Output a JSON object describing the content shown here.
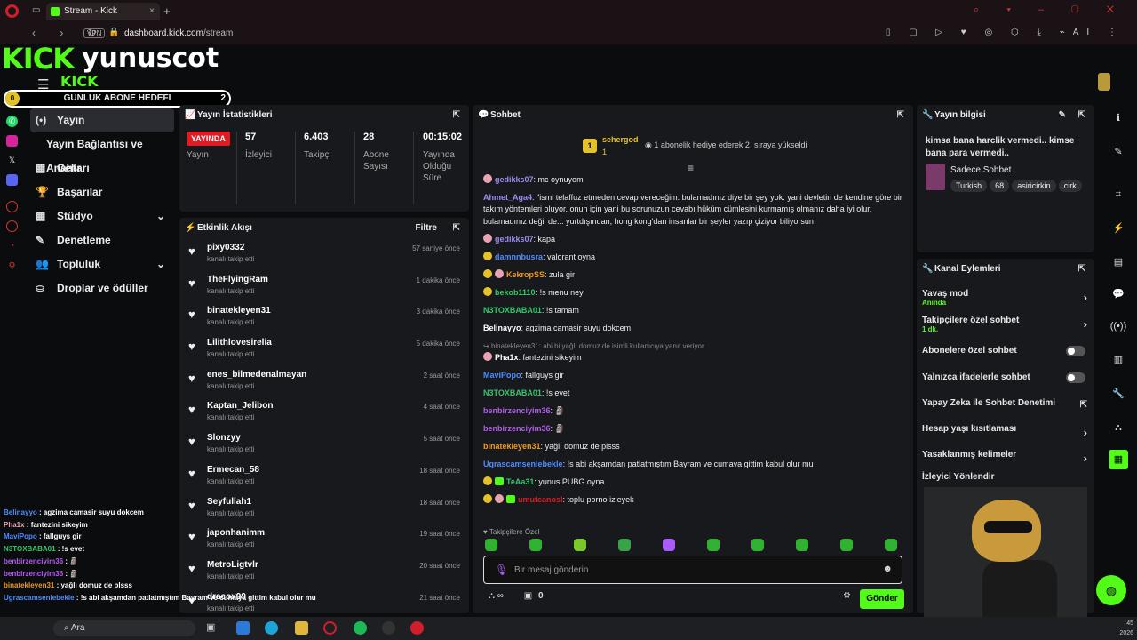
{
  "browser": {
    "tab_title": "Stream - Kick Dashboard",
    "url_domain": "dashboard.kick.com",
    "url_path": "/stream",
    "vpn": "VPN",
    "ext_label": "AI"
  },
  "header": {
    "logo": "KICK",
    "channel": "yunuscot",
    "logo_small": "KICK",
    "goal_label": "GUNLUK ABONE HEDEFI",
    "goal_start": "0",
    "goal_target": "2"
  },
  "sidenav": [
    {
      "label": "Yayın",
      "icon": "(•)"
    },
    {
      "label": "Yayın Bağlantısı ve Anahtarı",
      "icon": ""
    },
    {
      "label": "Gelir",
      "icon": "▦"
    },
    {
      "label": "Başarılar",
      "icon": "🏆"
    },
    {
      "label": "Stüdyo",
      "icon": "▦",
      "chev": "⌄"
    },
    {
      "label": "Denetleme",
      "icon": "✎"
    },
    {
      "label": "Topluluk",
      "icon": "👥",
      "chev": "⌄"
    },
    {
      "label": "Droplar ve ödüller",
      "icon": "⛀"
    }
  ],
  "stats": {
    "title": "Yayın İstatistikleri",
    "live": "YAYINDA",
    "live_label": "Yayın",
    "items": [
      {
        "value": "57",
        "label": "İzleyici"
      },
      {
        "value": "6.403",
        "label": "Takipçi"
      },
      {
        "value": "28",
        "label": "Abone Sayısı"
      },
      {
        "value": "00:15:02",
        "label": "Yayında Olduğu Süre"
      }
    ]
  },
  "activity": {
    "title": "Etkinlik Akışı",
    "filter": "Filtre",
    "sub": "kanalı takip etti",
    "items": [
      {
        "name": "pixy0332",
        "time": "57 saniye önce"
      },
      {
        "name": "TheFlyingRam",
        "time": "1 dakika önce"
      },
      {
        "name": "binatekleyen31",
        "time": "3 dakika önce"
      },
      {
        "name": "Lilithlovesirelia",
        "time": "5 dakika önce"
      },
      {
        "name": "enes_bilmedenalmayan",
        "time": "2 saat önce"
      },
      {
        "name": "Kaptan_Jelibon",
        "time": "4 saat önce"
      },
      {
        "name": "Slonzyy",
        "time": "5 saat önce"
      },
      {
        "name": "Ermecan_58",
        "time": "18 saat önce"
      },
      {
        "name": "Seyfullah1",
        "time": "18 saat önce"
      },
      {
        "name": "japonhanimm",
        "time": "19 saat önce"
      },
      {
        "name": "MetroLigtvlr",
        "time": "20 saat önce"
      },
      {
        "name": "dracox99",
        "time": "21 saat önce"
      }
    ]
  },
  "chat": {
    "title": "Sohbet",
    "pinned_user": "sehergod",
    "pinned_badge": "1",
    "pinned_sub": "1",
    "pinned_msg": "1 abonelik hediye ederek 2. sıraya yükseldi",
    "reply_note": "binatekleyen31: abi bi yağlı domuz de isimli kullanıcıya yanıt veriyor",
    "messages": [
      {
        "user": "gedikks07",
        "color": "#9b8cf0",
        "badge": "p",
        "text": "mc oynuyom"
      },
      {
        "user": "Ahmet_Aga4",
        "color": "#9b8cf0",
        "badge": "",
        "text": "\"ismi telaffuz etmeden cevap vereceğim. bulamadınız diye bir şey yok. yani devletin de kendine göre bir takım yöntemleri oluyor. onun için yani bu sorunuzun cevabı hüküm cümlesini kurmamış olmanız daha iyi olur. bulamadınız değil de... yurtdışından, hong kong'dan insanlar bir şeyler yazıp çiziyor biliyorsun"
      },
      {
        "user": "gedikks07",
        "color": "#9b8cf0",
        "badge": "p",
        "text": "kapa"
      },
      {
        "user": "damnnbusra",
        "color": "#4f8cff",
        "badge": "y",
        "text": "valorant oyna"
      },
      {
        "user": "KekropSS",
        "color": "#f09a1c",
        "badge": "yp",
        "text": "zula gir"
      },
      {
        "user": "bekob1110",
        "color": "#35c46b",
        "badge": "y",
        "text": "!s menu ney"
      },
      {
        "user": "N3TOXBABA01",
        "color": "#35c46b",
        "badge": "",
        "text": "!s tamam"
      },
      {
        "user": "Belinayyo",
        "color": "#ffffff",
        "badge": "",
        "text": "agzima camasir suyu dokcem"
      },
      {
        "user": "Pha1x",
        "color": "#ffffff",
        "badge": "p",
        "text": "fantezini sikeyim",
        "reply": true
      },
      {
        "user": "MaviPopo",
        "color": "#4f8cff",
        "badge": "",
        "text": "fallguys gir"
      },
      {
        "user": "N3TOXBABA01",
        "color": "#35c46b",
        "badge": "",
        "text": "!s evet"
      },
      {
        "user": "benbirzenciyim36",
        "color": "#b35cf0",
        "badge": "",
        "text": "🗿"
      },
      {
        "user": "benbirzenciyim36",
        "color": "#b35cf0",
        "badge": "",
        "text": "🗿"
      },
      {
        "user": "binatekleyen31",
        "color": "#f09a1c",
        "badge": "",
        "text": "yağlı domuz de plsss"
      },
      {
        "user": "Ugrascamsenlebekle",
        "color": "#4f8cff",
        "badge": "",
        "text": "!s abi akşamdan patlatmıştım Bayram ve cumaya gittim kabul olur mu"
      },
      {
        "user": "TeAa31",
        "color": "#35c46b",
        "badge": "yg",
        "text": "yunus PUBG oyna"
      },
      {
        "user": "umutcanosl",
        "color": "#e01b24",
        "badge": "ypg",
        "text": "toplu porno izleyek"
      }
    ],
    "emote_label": "Takipçilere Özel",
    "placeholder": "Bir mesaj gönderin",
    "points": "0",
    "send": "Gönder"
  },
  "info": {
    "title": "Yayın bilgisi",
    "stream_title": "kimsa bana harclik vermedi.. kimse bana para vermedi..",
    "category": "Sadece Sohbet",
    "tags": [
      "Turkish",
      "68",
      "asiricirkin",
      "cirk"
    ]
  },
  "actions": {
    "title": "Kanal Eylemleri",
    "items": [
      {
        "label": "Yavaş mod",
        "sub": "Anında",
        "ctrl": "arrow"
      },
      {
        "label": "Takipçilere özel sohbet",
        "sub": "1 dk.",
        "ctrl": "arrow"
      },
      {
        "label": "Abonelere özel sohbet",
        "sub": "",
        "ctrl": "toggle"
      },
      {
        "label": "Yalnızca ifadelerle sohbet",
        "sub": "",
        "ctrl": "toggle"
      },
      {
        "label": "Yapay Zeka ile Sohbet Denetimi",
        "sub": "",
        "ctrl": "ext"
      },
      {
        "label": "Hesap yaşı kısıtlaması",
        "sub": "",
        "ctrl": "arrow"
      },
      {
        "label": "Yasaklanmış kelimeler",
        "sub": "",
        "ctrl": "arrow"
      },
      {
        "label": "İzleyici Yönlendir",
        "sub": "",
        "ctrl": ""
      }
    ]
  },
  "overlay": [
    {
      "user": "Belinayyo",
      "color": "#4f8cff",
      "text": "agzima camasir suyu dokcem"
    },
    {
      "user": "Pha1x",
      "color": "#e8a4b4",
      "text": "fantezini sikeyim"
    },
    {
      "user": "MaviPopo",
      "color": "#4f8cff",
      "text": "fallguys gir"
    },
    {
      "user": "N3TOXBABA01",
      "color": "#35c46b",
      "text": "!s evet"
    },
    {
      "user": "benbirzenciyim36",
      "color": "#b35cf0",
      "text": "🗿"
    },
    {
      "user": "benbirzenciyim36",
      "color": "#b35cf0",
      "text": "🗿"
    },
    {
      "user": "binatekleyen31",
      "color": "#f09a1c",
      "text": "yağlı domuz de plsss"
    },
    {
      "user": "Ugrascamsenlebekle",
      "color": "#4f8cff",
      "text": "!s abi akşamdan patlatmıştım Bayram ve cumaya gittim kabul olur mu"
    }
  ],
  "taskbar": {
    "search": "Ara",
    "clock_tail": "45",
    "date_tail": "2026"
  },
  "colors": {
    "brand": "#53fc18",
    "live": "#e01b24",
    "gold": "#e6c229"
  }
}
